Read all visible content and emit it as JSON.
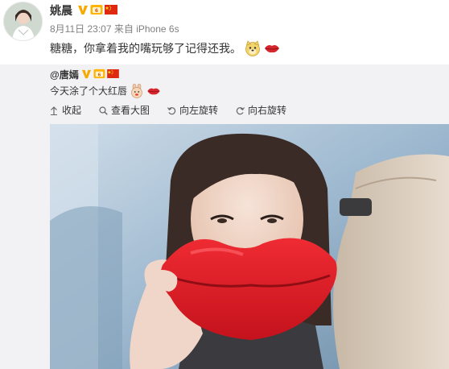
{
  "post": {
    "username": "姚晨",
    "date": "8月11日 23:07",
    "source_prefix": "来自",
    "source": "iPhone 6s",
    "text": "糖糖，你拿着我的嘴玩够了记得还我。",
    "emoji": [
      "doge-emoji",
      "lips-emoji"
    ]
  },
  "repost": {
    "username": "@唐嫣",
    "text": "今天涂了个大红唇",
    "emoji": [
      "rabbit-emoji",
      "lips-emoji"
    ],
    "toolbar": {
      "collapse": "收起",
      "view_large": "查看大图",
      "rotate_left": "向左旋转",
      "rotate_right": "向右旋转"
    }
  },
  "colors": {
    "verified": "#f7a900",
    "repost_bg": "#f2f2f5",
    "lips_red": "#e3202a"
  }
}
